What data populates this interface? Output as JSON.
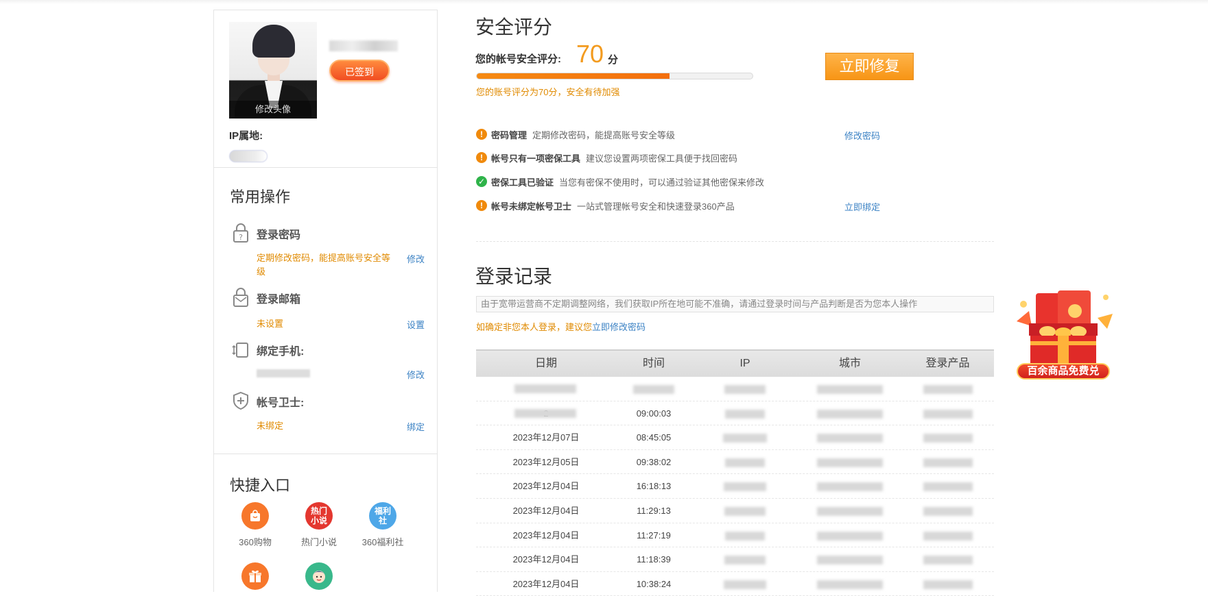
{
  "profile": {
    "edit_avatar_label": "修改头像",
    "signed_label": "已签到",
    "ip_label": "IP属地:"
  },
  "common_ops": {
    "title": "常用操作",
    "items": [
      {
        "title": "登录密码",
        "desc": "定期修改密码，能提高账号安全等级",
        "action": "修改",
        "icon": "lock-icon"
      },
      {
        "title": "登录邮箱",
        "desc": "未设置",
        "action": "设置",
        "icon": "mail-icon"
      },
      {
        "title": "绑定手机:",
        "desc": "",
        "action": "修改",
        "icon": "phone-icon"
      },
      {
        "title": "帐号卫士:",
        "desc": "未绑定",
        "action": "绑定",
        "icon": "shield-icon"
      }
    ]
  },
  "quick_entry": {
    "title": "快捷入口",
    "items": [
      {
        "label": "360购物",
        "icon": "shopping-bag-icon",
        "color": "#f7772b"
      },
      {
        "label": "热门小说",
        "icon_text": "热门\n小说",
        "color": "#e4372f"
      },
      {
        "label": "360福利社",
        "icon_text": "福利\n社",
        "color": "#4ea7e8"
      },
      {
        "label": "",
        "icon": "gift-icon",
        "color": "#f7772b"
      },
      {
        "label": "",
        "icon": "character-icon",
        "color": "#39b88b"
      }
    ]
  },
  "security": {
    "title": "安全评分",
    "score_label": "您的帐号安全评分:",
    "score": "70",
    "unit": "分",
    "progress": 0.7,
    "note": "您的账号评分为70分，安全有待加强",
    "fix_button": "立即修复",
    "checks": [
      {
        "status": "warn",
        "title": "密码管理",
        "desc": "定期修改密码，能提高账号安全等级",
        "action": "修改密码"
      },
      {
        "status": "warn",
        "title": "帐号只有一项密保工具",
        "desc": "建议您设置两项密保工具便于找回密码",
        "action": ""
      },
      {
        "status": "ok",
        "title": "密保工具已验证",
        "desc": "当您有密保不使用时，可以通过验证其他密保来修改",
        "action": ""
      },
      {
        "status": "warn",
        "title": "帐号未绑定帐号卫士",
        "desc": "一站式管理帐号安全和快速登录360产品",
        "action": "立即绑定"
      }
    ]
  },
  "login_records": {
    "title": "登录记录",
    "notice": "由于宽带运营商不定期调整网络，我们获取IP所在地可能不准确，请通过登录时间与产品判断是否为您本人操作",
    "confirm_prefix": "如确定非您本人登录，建议您",
    "confirm_link": "立即修改密码",
    "columns": [
      "日期",
      "时间",
      "IP",
      "城市",
      "登录产品"
    ],
    "rows": [
      {
        "date": "",
        "time": ""
      },
      {
        "date": "2",
        "time": "09:00:03"
      },
      {
        "date": "2023年12月07日",
        "time": "08:45:05"
      },
      {
        "date": "2023年12月05日",
        "time": "09:38:02"
      },
      {
        "date": "2023年12月04日",
        "time": "16:18:13"
      },
      {
        "date": "2023年12月04日",
        "time": "11:29:13"
      },
      {
        "date": "2023年12月04日",
        "time": "11:27:19"
      },
      {
        "date": "2023年12月04日",
        "time": "11:18:39"
      },
      {
        "date": "2023年12月04日",
        "time": "10:38:24"
      }
    ]
  },
  "promo": {
    "label": "百余商品免费兑"
  }
}
